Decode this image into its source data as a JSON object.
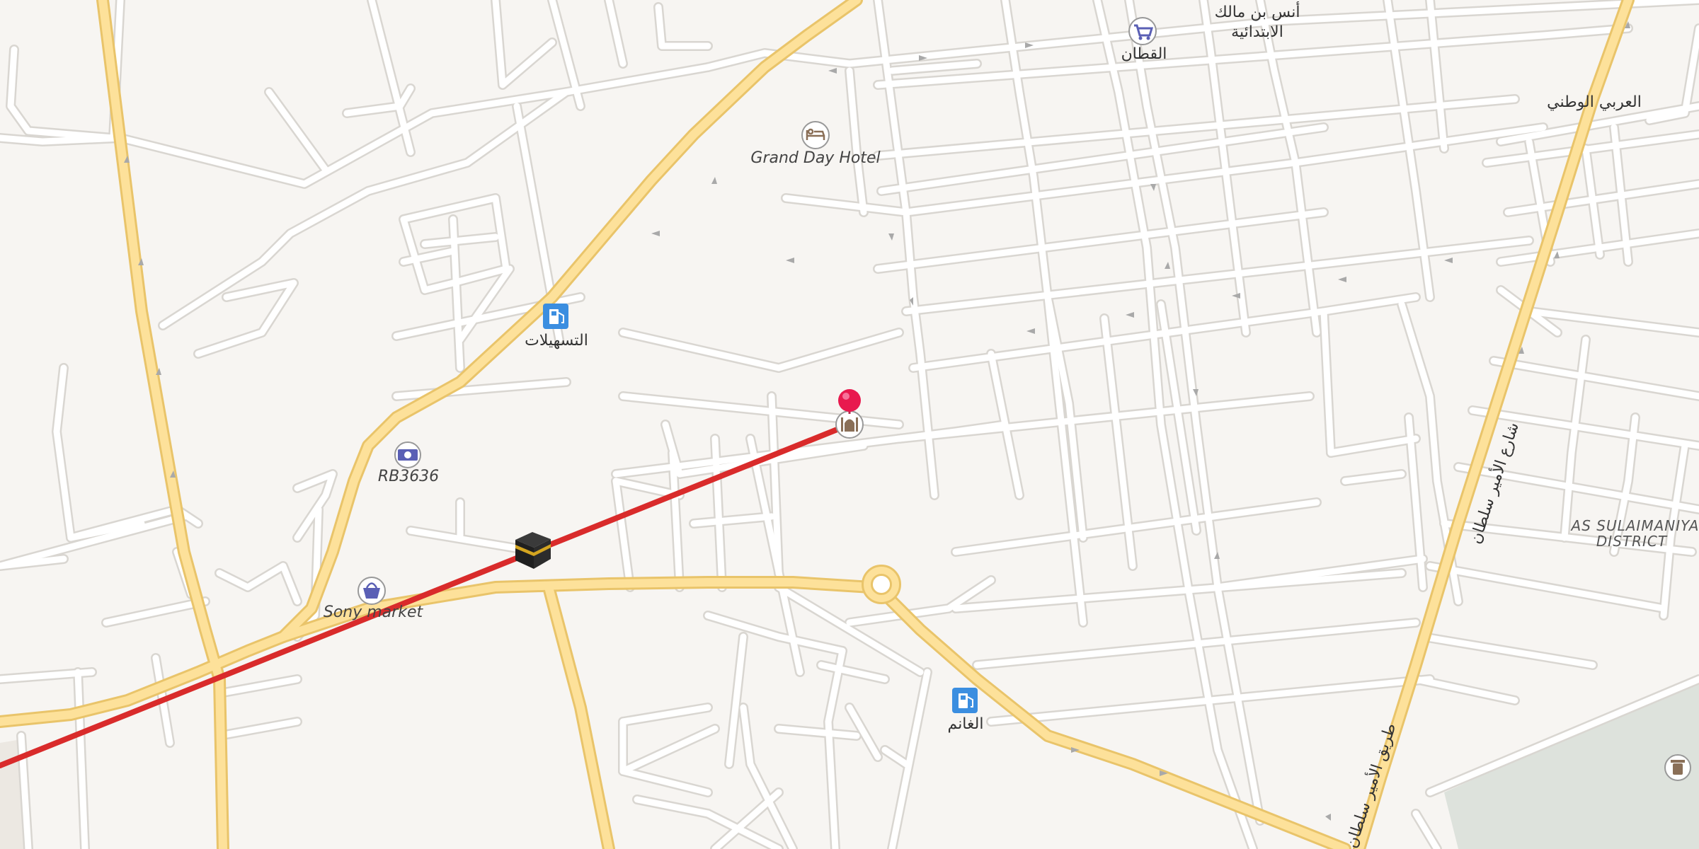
{
  "map": {
    "labels": {
      "grand_day_hotel": "Grand Day Hotel",
      "al_tasheelat": "التسهيلات",
      "rb3636": "RB3636",
      "sony_market": "Sony market",
      "al_ghanem": "الغانم",
      "al_qattan": "القطان",
      "anas_school_line1": "أنس بن مالك",
      "anas_school_line2": "الابتدائية",
      "arabi_watani": "العربي الوطني",
      "district_line1": "AS SULAIMANIYA",
      "district_line2": "DISTRICT",
      "road_east": "شارع الأمير سلطان",
      "road_southeast": "طريق الأمير سلطان"
    },
    "icons": {
      "hotel": "bed-icon",
      "fuel_1": "fuel-pump-icon",
      "fuel_2": "fuel-pump-icon",
      "bank": "banknote-icon",
      "market": "shopping-basket-icon",
      "shop": "shopping-cart-icon",
      "mosque": "mosque-icon",
      "kaaba": "kaaba-icon",
      "pin": "location-pin-icon",
      "trash": "trash-can-icon"
    },
    "colors": {
      "background": "#f7f5f2",
      "major_road": "#fde19a",
      "minor_road": "#ffffff",
      "route_line": "#d92b2b",
      "pin": "#e8194e",
      "poi_blue": "#3b8ee0",
      "park": "#dde2dc"
    }
  }
}
